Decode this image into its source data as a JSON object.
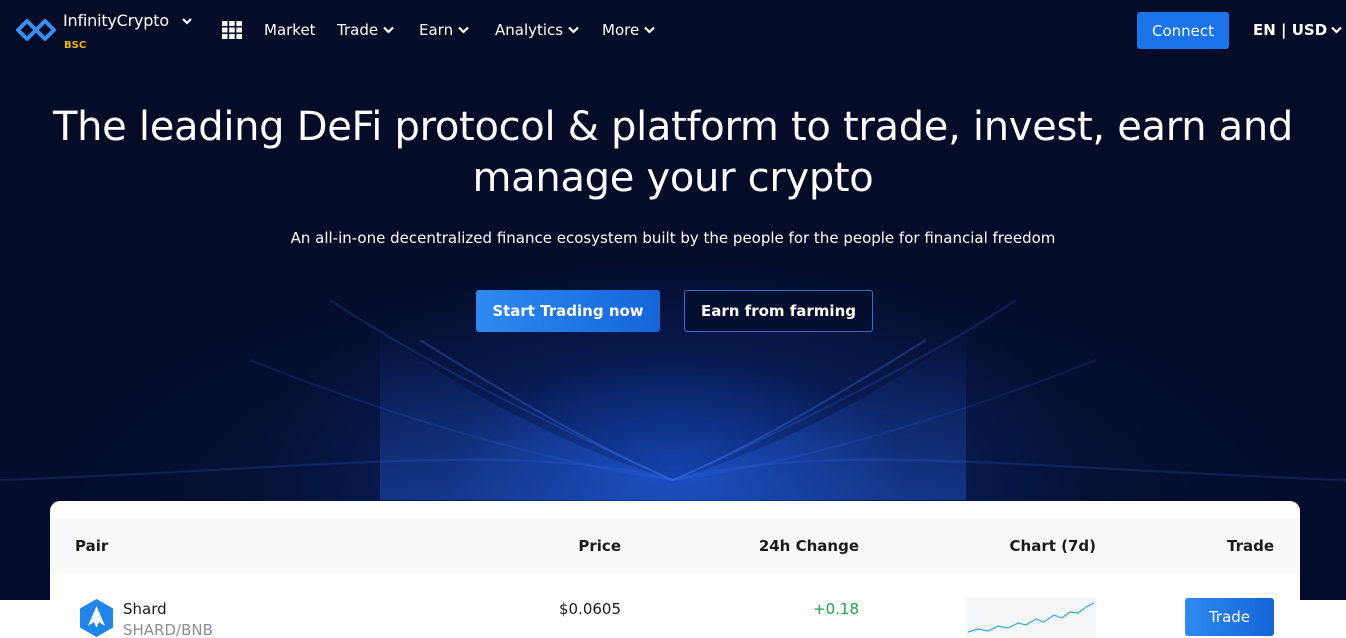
{
  "nav": {
    "brand": "InfinityCrypto",
    "network": "BSC",
    "menu": [
      {
        "label": "Market",
        "has_dropdown": false
      },
      {
        "label": "Trade",
        "has_dropdown": true
      },
      {
        "label": "Earn",
        "has_dropdown": true
      },
      {
        "label": "Analytics",
        "has_dropdown": true
      },
      {
        "label": "More",
        "has_dropdown": true
      }
    ],
    "connect_label": "Connect",
    "locale": "EN | USD",
    "icons": {
      "logo": "infinity-logo-icon",
      "apps": "grid-icon",
      "dropdown": "chevron-down-icon"
    }
  },
  "hero": {
    "title": "The leading DeFi protocol & platform to trade, invest, earn and manage your crypto",
    "subtitle": "An all-in-one decentralized finance ecosystem built by the people for the people for financial freedom",
    "primary_cta": "Start Trading now",
    "secondary_cta": "Earn from farming"
  },
  "table": {
    "headers": {
      "pair": "Pair",
      "price": "Price",
      "change": "24h Change",
      "chart": "Chart (7d)",
      "trade": "Trade"
    },
    "rows": [
      {
        "name": "Shard",
        "pair": "SHARD/BNB",
        "price": "$0.0605",
        "change": "+0.18",
        "trade_label": "Trade",
        "icon": "shard-token-icon"
      }
    ]
  },
  "colors": {
    "background": "#030b26",
    "accent": "#1a73e8",
    "network_badge": "#f0b90b",
    "positive": "#1ba34c"
  }
}
